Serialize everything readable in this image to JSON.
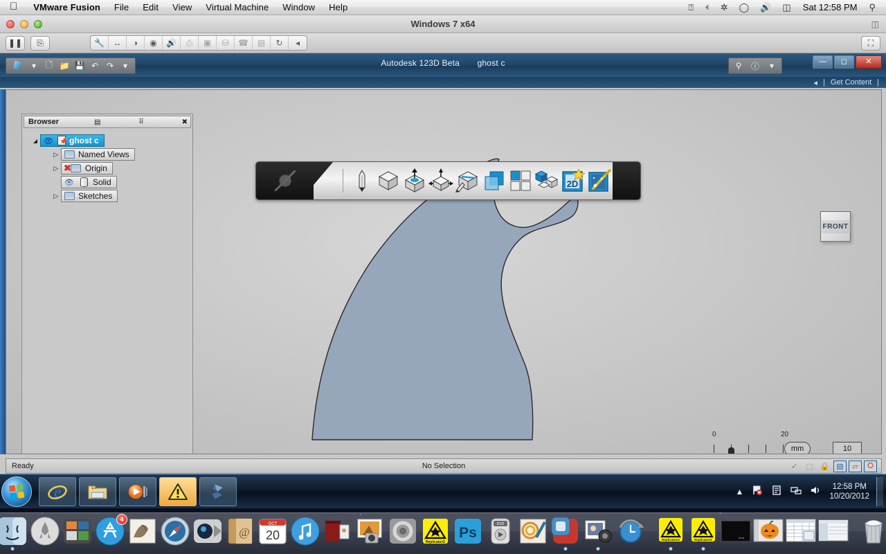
{
  "mac_menubar": {
    "apple_icon": "apple-logo",
    "items": [
      {
        "label": "VMware Fusion",
        "bold": true
      },
      {
        "label": "File",
        "bold": false
      },
      {
        "label": "Edit",
        "bold": false
      },
      {
        "label": "View",
        "bold": false
      },
      {
        "label": "Virtual Machine",
        "bold": false
      },
      {
        "label": "Window",
        "bold": false
      },
      {
        "label": "Help",
        "bold": false
      }
    ],
    "status_icons": [
      {
        "name": "vmware-unity-icon",
        "glyph": "❐"
      },
      {
        "name": "time-machine-icon",
        "glyph": "◴"
      },
      {
        "name": "bluetooth-icon",
        "glyph": "ʙ"
      },
      {
        "name": "wifi-icon",
        "glyph": "▽"
      },
      {
        "name": "volume-icon",
        "glyph": "◂)"
      },
      {
        "name": "battery-icon",
        "glyph": "▭"
      }
    ],
    "clock": "Sat 12:58 PM",
    "spotlight_icon": "search-icon"
  },
  "vmware_window": {
    "title": "Windows 7 x64",
    "traffic_lights": [
      "close",
      "minimize",
      "zoom"
    ],
    "left_buttons": [
      {
        "name": "pause-button",
        "glyph": "‖"
      },
      {
        "name": "snapshot-button",
        "glyph": "⎙"
      }
    ],
    "device_icons": [
      {
        "name": "settings-wrench-icon",
        "glyph": "⚒"
      },
      {
        "name": "network-icon",
        "glyph": "↔"
      },
      {
        "name": "hard-disk-icon",
        "glyph": "◔"
      },
      {
        "name": "cd-drive-icon",
        "glyph": "◓"
      },
      {
        "name": "sound-icon",
        "glyph": "◂"
      },
      {
        "name": "printer-icon",
        "glyph": "⎙"
      },
      {
        "name": "usb-disk-icon",
        "glyph": "▣"
      },
      {
        "name": "mouse-icon",
        "glyph": "⛁"
      },
      {
        "name": "phone-icon",
        "glyph": "✆"
      },
      {
        "name": "floppy-icon",
        "glyph": "▤"
      },
      {
        "name": "sync-icon",
        "glyph": "↻"
      },
      {
        "name": "collapse-arrow-icon",
        "glyph": "◂"
      }
    ],
    "fullscreen_icon": "fullscreen-icon"
  },
  "autodesk": {
    "app_name": "Autodesk 123D Beta",
    "document_name": "ghost c",
    "quick_access": [
      {
        "name": "new-document-button",
        "glyph": "□"
      },
      {
        "name": "open-document-button",
        "glyph": "▷"
      },
      {
        "name": "save-document-button",
        "glyph": "▤"
      },
      {
        "name": "undo-button",
        "glyph": "↶"
      },
      {
        "name": "redo-button",
        "glyph": "↷"
      },
      {
        "name": "customize-qat-button",
        "glyph": "▾"
      }
    ],
    "help_group": [
      {
        "name": "sign-in-icon",
        "glyph": "☂"
      },
      {
        "name": "help-icon",
        "glyph": "?"
      },
      {
        "name": "help-dropdown-icon",
        "glyph": "▾"
      }
    ],
    "window_controls": [
      {
        "name": "minimize-button",
        "glyph": "—"
      },
      {
        "name": "maximize-button",
        "glyph": "□"
      },
      {
        "name": "close-button",
        "glyph": "✕"
      }
    ],
    "ribbon_strip": {
      "collapse_icon": "◂",
      "divider": "|",
      "get_content_label": "Get Content",
      "trailing_divider": "|"
    },
    "browser": {
      "title": "Browser",
      "header_icons": [
        {
          "name": "browser-filter-icon",
          "glyph": "☷"
        },
        {
          "name": "browser-undock-icon",
          "glyph": "⫼"
        },
        {
          "name": "browser-close-icon",
          "glyph": "✕"
        }
      ],
      "tree": [
        {
          "label": "ghost c",
          "level": 0,
          "expander": "expanded",
          "selected": true,
          "icons": [
            "eye-icon",
            "document-pin-icon"
          ]
        },
        {
          "label": "Named Views",
          "level": 1,
          "expander": "collapsed",
          "selected": false,
          "icons": [
            "folder-icon"
          ]
        },
        {
          "label": "Origin",
          "level": 1,
          "expander": "collapsed",
          "selected": false,
          "icons": [
            "hidden-x-icon",
            "folder-icon"
          ]
        },
        {
          "label": "Solid",
          "level": 1,
          "expander": "none",
          "selected": false,
          "icons": [
            "eye-icon",
            "cylinder-icon"
          ]
        },
        {
          "label": "Sketches",
          "level": 1,
          "expander": "collapsed",
          "selected": false,
          "icons": [
            "folder-icon"
          ]
        }
      ]
    },
    "model_toolbar": {
      "logo_name": "123d-cube-logo-icon",
      "tools": [
        {
          "name": "sketch-pencil-icon"
        },
        {
          "name": "primitives-cube-icon"
        },
        {
          "name": "construct-extrude-icon"
        },
        {
          "name": "modify-transform-icon"
        },
        {
          "name": "sketch-on-face-icon"
        },
        {
          "name": "combine-boolean-icon"
        },
        {
          "name": "pattern-grid-icon"
        },
        {
          "name": "assemble-blocks-icon"
        },
        {
          "name": "2d-drawing-icon"
        },
        {
          "name": "effects-magic-wand-icon"
        }
      ]
    },
    "viewcube": {
      "face_label": "FRONT"
    },
    "navigation_bar": {
      "close_icon": "✕",
      "more_icon": "−",
      "tools": [
        {
          "name": "steering-wheel-icon",
          "has_caret": true
        },
        {
          "name": "pan-hand-icon",
          "has_caret": false
        },
        {
          "name": "zoom-magnifier-icon",
          "has_caret": true
        },
        {
          "name": "orbit-icon",
          "has_caret": true
        },
        {
          "name": "look-at-icon",
          "has_caret": false
        },
        {
          "name": "display-cube-icon",
          "has_caret": true
        }
      ]
    },
    "scale_widget": {
      "tick_labels": [
        "0",
        "20"
      ],
      "tick_count": 5,
      "unit": "mm",
      "value": "5",
      "zoom_value": "10"
    },
    "status_bar": {
      "ready_text": "Ready",
      "selection_text": "No Selection",
      "icons": [
        {
          "name": "sketch-constraint-icon",
          "glyph": "✓",
          "highlighted": false
        },
        {
          "name": "snap-grid-icon",
          "glyph": "⬚",
          "highlighted": false
        },
        {
          "name": "lock-icon",
          "glyph": "⚿",
          "highlighted": false
        },
        {
          "name": "display-mode-icon",
          "glyph": "▤",
          "highlighted": true
        },
        {
          "name": "shaded-view-icon",
          "glyph": "▱",
          "highlighted": true
        },
        {
          "name": "orbit-toggle-icon",
          "glyph": "◌",
          "highlighted": true,
          "red": true
        }
      ]
    },
    "sketch_shape": {
      "name": "ghost-profile-sketch",
      "fill_color": "#97a7bb",
      "stroke_color": "#2a2a2a"
    }
  },
  "windows_taskbar": {
    "start_button": "start-orb",
    "items": [
      {
        "name": "taskbar-internet-explorer",
        "glyph": "e",
        "active": false
      },
      {
        "name": "taskbar-windows-explorer",
        "glyph": "▤",
        "active": false
      },
      {
        "name": "taskbar-media-player",
        "glyph": "▶",
        "active": false
      },
      {
        "name": "taskbar-warning-app",
        "glyph": "⚠",
        "active": true
      },
      {
        "name": "taskbar-autodesk-123d",
        "glyph": "➦",
        "active": false
      }
    ],
    "tray": {
      "show_hidden_icon": "▲",
      "icons": [
        {
          "name": "action-center-flag-icon",
          "glyph": "⚑"
        },
        {
          "name": "device-icon",
          "glyph": "⎙"
        },
        {
          "name": "network-icon",
          "glyph": "▥"
        },
        {
          "name": "volume-icon",
          "glyph": "◂"
        }
      ],
      "time": "12:58 PM",
      "date": "10/20/2012"
    }
  },
  "mac_dock": {
    "items": [
      {
        "name": "dock-finder",
        "label": "Finder",
        "running": true
      },
      {
        "name": "dock-launchpad",
        "label": "Launchpad",
        "running": false
      },
      {
        "name": "dock-mission-control",
        "label": "Mission Control",
        "running": false
      },
      {
        "name": "dock-app-store",
        "label": "App Store",
        "running": false,
        "badge": "4"
      },
      {
        "name": "dock-mail",
        "label": "Mail",
        "running": false
      },
      {
        "name": "dock-safari",
        "label": "Safari",
        "running": false
      },
      {
        "name": "dock-facetime",
        "label": "FaceTime",
        "running": false
      },
      {
        "name": "dock-contacts",
        "label": "Contacts",
        "running": false
      },
      {
        "name": "dock-calendar",
        "label": "Calendar",
        "running": false,
        "day": "20"
      },
      {
        "name": "dock-itunes",
        "label": "iTunes",
        "running": false
      },
      {
        "name": "dock-photo-booth",
        "label": "Photo Booth",
        "running": false
      },
      {
        "name": "dock-iphoto",
        "label": "iPhoto",
        "running": false
      },
      {
        "name": "dock-system-preferences",
        "label": "System Preferences",
        "running": false
      },
      {
        "name": "dock-replicatorg",
        "label": "ReplicatorG",
        "running": false
      },
      {
        "name": "dock-photoshop",
        "label": "Ps",
        "running": false
      },
      {
        "name": "dock-dvd-player",
        "label": "DVD Player",
        "running": false
      },
      {
        "name": "dock-paintbrush",
        "label": "Paintbrush",
        "running": false
      },
      {
        "name": "dock-vmware-fusion",
        "label": "VMware Fusion",
        "running": true
      },
      {
        "name": "dock-imovie",
        "label": "iMovie",
        "running": true
      },
      {
        "name": "dock-time-machine",
        "label": "Time Machine",
        "running": false
      }
    ],
    "minimized": [
      {
        "name": "dock-replicatorg-window-1",
        "label": "ReplicatorG",
        "running": true
      },
      {
        "name": "dock-replicatorg-window-2",
        "label": "ReplicatorG",
        "running": true
      },
      {
        "name": "dock-terminal-window",
        "label": "Terminal",
        "running": false
      },
      {
        "name": "dock-pumpkin-window",
        "label": "Pumpkin",
        "running": false
      },
      {
        "name": "dock-spreadsheet-window",
        "label": "Spreadsheet",
        "running": false
      },
      {
        "name": "dock-finder-window",
        "label": "Finder Window",
        "running": false
      }
    ],
    "trash": {
      "name": "dock-trash",
      "label": "Trash"
    }
  }
}
